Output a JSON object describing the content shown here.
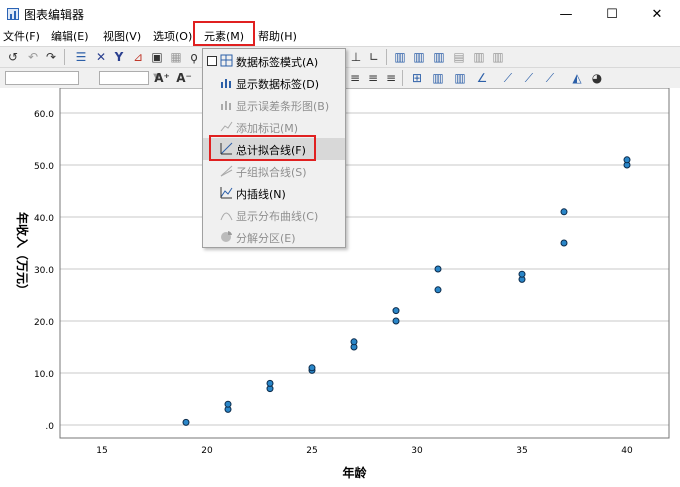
{
  "window": {
    "title": "图表编辑器",
    "minimize_glyph": "—",
    "maximize_glyph": "☐",
    "close_glyph": "✕"
  },
  "menubar": {
    "items": [
      "文件(F)",
      "编辑(E)",
      "视图(V)",
      "选项(O)",
      "元素(M)",
      "帮助(H)"
    ],
    "open_menu": "元素(M)"
  },
  "toolbar_icons": [
    "undo-icon",
    "redo-icon",
    "forward-icon",
    "properties-icon",
    "delete-icon",
    "filter-icon",
    "scale-icon",
    "lasso-icon",
    "grid-icon"
  ],
  "element_menu": {
    "items": [
      {
        "label": "数据标签模式(A)",
        "enabled": true,
        "checkbox": true,
        "icon": "data-label-mode-icon"
      },
      {
        "label": "显示数据标签(D)",
        "enabled": true,
        "icon": "show-data-labels-icon"
      },
      {
        "label": "显示误差条形图(B)",
        "enabled": false,
        "icon": "error-bars-icon"
      },
      {
        "label": "添加标记(M)",
        "enabled": false,
        "icon": "add-markers-icon"
      },
      {
        "label": "总计拟合线(F)",
        "enabled": true,
        "highlighted": true,
        "icon": "fit-line-total-icon"
      },
      {
        "label": "子组拟合线(S)",
        "enabled": false,
        "icon": "fit-line-subgroups-icon"
      },
      {
        "label": "内插线(N)",
        "enabled": true,
        "icon": "interpolation-line-icon"
      },
      {
        "label": "显示分布曲线(C)",
        "enabled": false,
        "icon": "distribution-curve-icon"
      },
      {
        "label": "分解分区(E)",
        "enabled": false,
        "icon": "explode-slice-icon"
      }
    ]
  },
  "colors": {
    "marker_fill": "#2a86c8",
    "marker_stroke": "#0b2a4a",
    "gridline": "#c8c8c8",
    "highlight_red": "#e02020"
  },
  "chart_data": {
    "type": "scatter",
    "xlabel": "年龄",
    "ylabel": "年收入（万元）",
    "xlim": [
      13,
      42
    ],
    "ylim": [
      0,
      60
    ],
    "x_ticks": [
      "15",
      "20",
      "25",
      "30",
      "35",
      "40"
    ],
    "y_ticks": [
      ".0",
      "10.0",
      "20.0",
      "30.0",
      "40.0",
      "50.0",
      "60.0"
    ],
    "grid": true,
    "points": [
      {
        "x": 19,
        "y": 0.5
      },
      {
        "x": 21,
        "y": 3
      },
      {
        "x": 21,
        "y": 4
      },
      {
        "x": 23,
        "y": 7
      },
      {
        "x": 23,
        "y": 8
      },
      {
        "x": 25,
        "y": 10.5
      },
      {
        "x": 25,
        "y": 11
      },
      {
        "x": 27,
        "y": 15
      },
      {
        "x": 27,
        "y": 16
      },
      {
        "x": 29,
        "y": 20
      },
      {
        "x": 29,
        "y": 22
      },
      {
        "x": 31,
        "y": 26
      },
      {
        "x": 31,
        "y": 30
      },
      {
        "x": 35,
        "y": 28
      },
      {
        "x": 35,
        "y": 29
      },
      {
        "x": 37,
        "y": 35
      },
      {
        "x": 37,
        "y": 41
      },
      {
        "x": 40,
        "y": 50
      },
      {
        "x": 40,
        "y": 51
      }
    ]
  }
}
